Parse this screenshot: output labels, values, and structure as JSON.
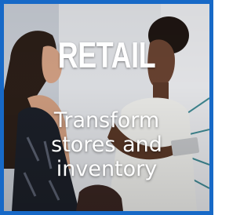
{
  "tile": {
    "title": "RETAIL",
    "subtitle_lines": [
      "Transform",
      "stores and",
      "inventory"
    ],
    "border_color": "#1769c7",
    "text_color": "#ffffff"
  }
}
